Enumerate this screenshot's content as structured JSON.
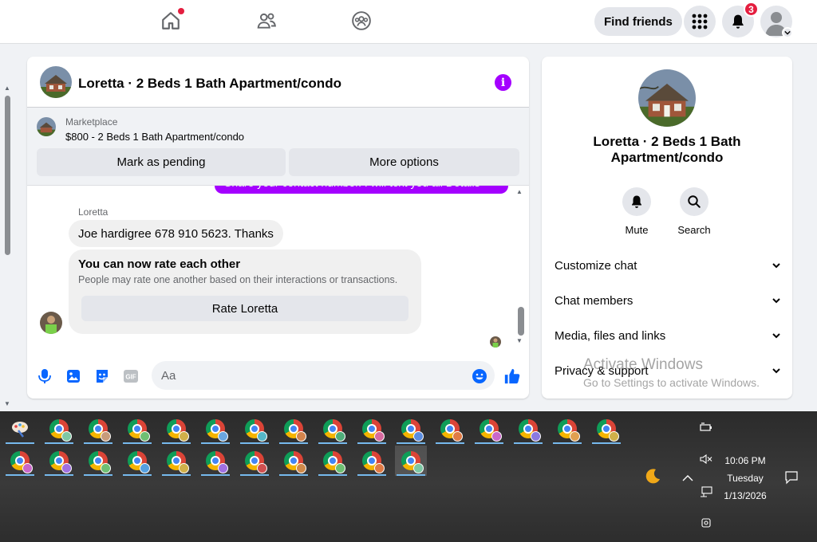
{
  "nav": {
    "find_friends": "Find friends",
    "notification_count": "3"
  },
  "chat": {
    "title": "Loretta · 2 Beds 1 Bath Apartment/condo",
    "marketplace_label": "Marketplace",
    "listing": "$800 - 2 Beds 1 Bath Apartment/condo",
    "mark_pending": "Mark as pending",
    "more_options": "More options",
    "partial_message": "Share your contact number. I will text you all Details",
    "sender_name": "Loretta",
    "message": "Joe hardigree 678 910 5623. Thanks",
    "rate_title": "You can now rate each other",
    "rate_subtitle": "People may rate one another based on their interactions or transactions.",
    "rate_button": "Rate Loretta",
    "composer_placeholder": "Aa"
  },
  "panel": {
    "title": "Loretta · 2 Beds 1 Bath Apartment/condo",
    "mute": "Mute",
    "search": "Search",
    "rows": [
      "Customize chat",
      "Chat members",
      "Media, files and links",
      "Privacy & support"
    ]
  },
  "watermark": {
    "line1": "Activate Windows",
    "line2": "Go to Settings to activate Windows."
  },
  "taskbar": {
    "time": "10:06 PM",
    "day": "Tuesday",
    "date": "1/13/2026"
  },
  "colors": {
    "messenger_purple": "#a400ff",
    "facebook_blue": "#0866ff",
    "badge_red": "#e41e3f"
  }
}
